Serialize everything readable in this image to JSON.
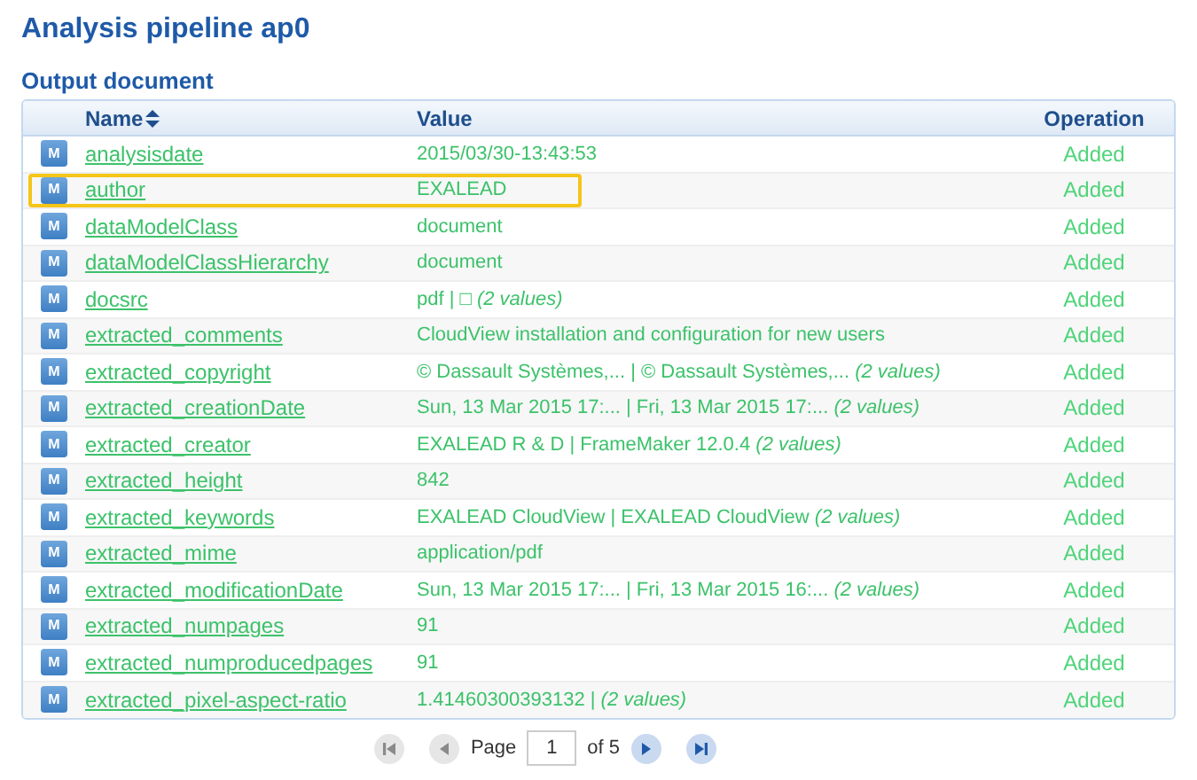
{
  "title": "Analysis pipeline ap0",
  "section": "Output document",
  "table": {
    "columns": [
      {
        "label": "Name",
        "sortable": true
      },
      {
        "label": "Value",
        "sortable": false
      },
      {
        "label": "Operation",
        "sortable": false
      }
    ],
    "rows": [
      {
        "badge": "M",
        "name": "analysisdate",
        "value": "2015/03/30-13:43:53",
        "operation": "Added",
        "highlighted": false
      },
      {
        "badge": "M",
        "name": "author",
        "value": "EXALEAD",
        "operation": "Added",
        "highlighted": true
      },
      {
        "badge": "M",
        "name": "dataModelClass",
        "value": "document",
        "operation": "Added",
        "highlighted": false
      },
      {
        "badge": "M",
        "name": "dataModelClassHierarchy",
        "value": "document",
        "operation": "Added",
        "highlighted": false
      },
      {
        "badge": "M",
        "name": "docsrc",
        "value": "pdf | □ *(2 values)*",
        "operation": "Added",
        "highlighted": false
      },
      {
        "badge": "M",
        "name": "extracted_comments",
        "value": "CloudView installation and configuration for new users",
        "operation": "Added",
        "highlighted": false
      },
      {
        "badge": "M",
        "name": "extracted_copyright",
        "value": "© Dassault Systèmes,... | © Dassault Systèmes,... *(2 values)*",
        "operation": "Added",
        "highlighted": false
      },
      {
        "badge": "M",
        "name": "extracted_creationDate",
        "value": "Sun, 13 Mar 2015 17:... | Fri, 13 Mar 2015 17:... *(2 values)*",
        "operation": "Added",
        "highlighted": false
      },
      {
        "badge": "M",
        "name": "extracted_creator",
        "value": "EXALEAD R & D | FrameMaker 12.0.4 *(2 values)*",
        "operation": "Added",
        "highlighted": false
      },
      {
        "badge": "M",
        "name": "extracted_height",
        "value": "842",
        "operation": "Added",
        "highlighted": false
      },
      {
        "badge": "M",
        "name": "extracted_keywords",
        "value": "EXALEAD CloudView | EXALEAD CloudView *(2 values)*",
        "operation": "Added",
        "highlighted": false
      },
      {
        "badge": "M",
        "name": "extracted_mime",
        "value": "application/pdf",
        "operation": "Added",
        "highlighted": false
      },
      {
        "badge": "M",
        "name": "extracted_modificationDate",
        "value": "Sun, 13 Mar 2015 17:... | Fri, 13 Mar 2015 16:... *(2 values)*",
        "operation": "Added",
        "highlighted": false
      },
      {
        "badge": "M",
        "name": "extracted_numpages",
        "value": "91",
        "operation": "Added",
        "highlighted": false
      },
      {
        "badge": "M",
        "name": "extracted_numproducedpages",
        "value": "91",
        "operation": "Added",
        "highlighted": false
      },
      {
        "badge": "M",
        "name": "extracted_pixel-aspect-ratio",
        "value": "1.41460300393132 | *(2 values)*",
        "operation": "Added",
        "highlighted": false
      }
    ]
  },
  "pager": {
    "label": "Page",
    "page": "1",
    "total": "of 5",
    "first_enabled": false,
    "prev_enabled": false,
    "next_enabled": true,
    "last_enabled": true
  }
}
